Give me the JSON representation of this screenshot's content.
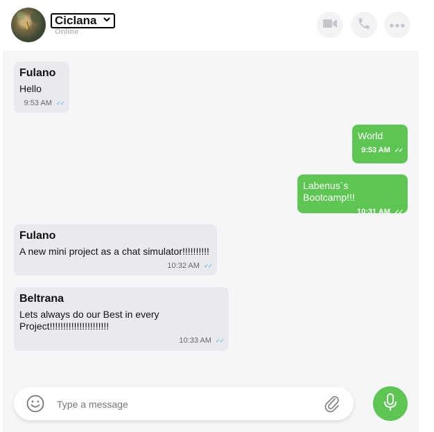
{
  "header": {
    "contact_name": "Ciclana",
    "status": "Online"
  },
  "messages": [
    {
      "direction": "in",
      "sender": "Fulano",
      "text": "Hello",
      "time": "9:53 AM"
    },
    {
      "direction": "out",
      "sender": "",
      "text": "World",
      "time": "9:53 AM"
    },
    {
      "direction": "out",
      "sender": "",
      "text": "Labenus´s Bootcamp!!!",
      "time": "10:31 AM"
    },
    {
      "direction": "in",
      "sender": "Fulano",
      "text": "A new mini project as a chat simulator!!!!!!!!!!",
      "time": "10:32 AM"
    },
    {
      "direction": "in",
      "sender": "Beltrana",
      "text": "Lets always do our Best in every Project!!!!!!!!!!!!!!!!!!!!!!",
      "time": "10:33 AM"
    }
  ],
  "composer": {
    "placeholder": "Type a message",
    "value": ""
  },
  "colors": {
    "accent": "#5dc653",
    "incoming_bubble": "#e8eaed",
    "chat_background": "#f5f6f8",
    "read_tick": "#5ab4e8"
  },
  "icons": {
    "video": "video-camera-icon",
    "call": "phone-icon",
    "menu": "more-dots-icon",
    "emoji": "smiley-icon",
    "attach": "paperclip-icon",
    "mic": "microphone-icon"
  }
}
